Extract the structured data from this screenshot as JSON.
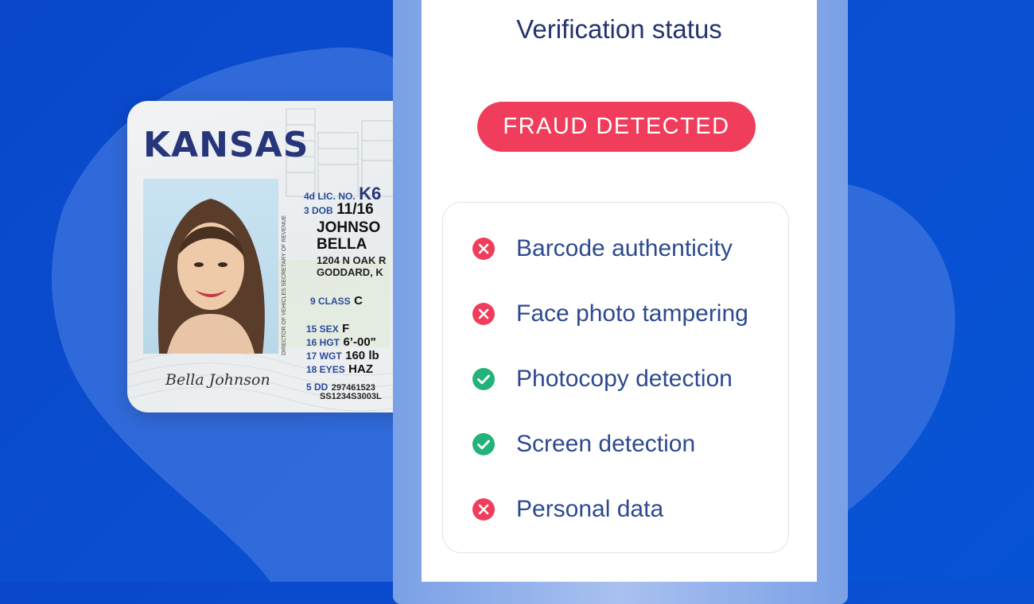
{
  "colors": {
    "background": "#0b4fd1",
    "fail": "#f13d5c",
    "pass": "#22b27a",
    "title": "#24346e",
    "label": "#2d4a8e"
  },
  "id_card": {
    "state": "KANSAS",
    "signature": "Bella Johnson",
    "lic_no_label": "4d LIC. NO.",
    "lic_no": "K6",
    "dob_label": "3 DOB",
    "dob": "11/16",
    "last_name": "JOHNSO",
    "first_name": "BELLA",
    "address_line1": "1204 N OAK R",
    "address_line2": "GODDARD, K",
    "class_label": "9 CLASS",
    "class": "C",
    "sex_label": "15 SEX",
    "sex": "F",
    "hgt_label": "16 HGT",
    "hgt": "6’-00\"",
    "wgt_label": "17 WGT",
    "wgt": "160 lb",
    "eyes_label": "18 EYES",
    "eyes": "HAZ",
    "dd_label": "5 DD",
    "dd": "297461523",
    "dd_line2": "SS1234S3003L",
    "side_text": "DIRECTOR OF VEHICLES   SECRETARY OF REVENUE"
  },
  "screen": {
    "title": "Verification status",
    "status_badge": "FRAUD DETECTED",
    "checks": [
      {
        "label": "Barcode authenticity",
        "status": "fail",
        "icon": "x-circle-icon"
      },
      {
        "label": "Face photo tampering",
        "status": "fail",
        "icon": "x-circle-icon"
      },
      {
        "label": "Photocopy detection",
        "status": "pass",
        "icon": "check-circle-icon"
      },
      {
        "label": "Screen detection",
        "status": "pass",
        "icon": "check-circle-icon"
      },
      {
        "label": "Personal data",
        "status": "fail",
        "icon": "x-circle-icon"
      }
    ]
  }
}
